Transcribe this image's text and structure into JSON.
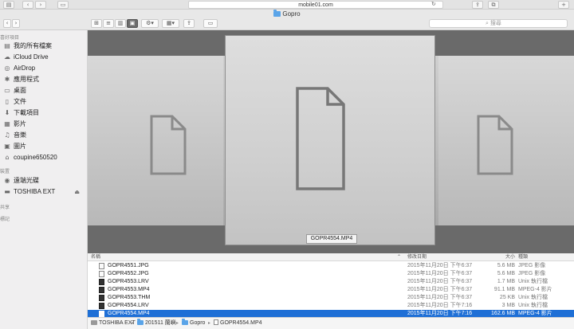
{
  "safari": {
    "url": "mobile01.com",
    "back_icon": "chevron-left-icon",
    "forward_icon": "chevron-right-icon",
    "sidebar_icon": "sidebar-icon",
    "share_icon": "share-icon",
    "reload_icon": "reload-icon",
    "tabs_icon": "tabs-icon"
  },
  "finder": {
    "title": "Gopro",
    "search_placeholder": "搜尋"
  },
  "sidebar": {
    "favorites_header": "喜好項目",
    "favorites": [
      {
        "label": "我的所有檔案",
        "icon": "all-files-icon",
        "glyph": "▤"
      },
      {
        "label": "iCloud Drive",
        "icon": "cloud-icon",
        "glyph": "☁"
      },
      {
        "label": "AirDrop",
        "icon": "airdrop-icon",
        "glyph": "◎"
      },
      {
        "label": "應用程式",
        "icon": "applications-icon",
        "glyph": "✱"
      },
      {
        "label": "桌面",
        "icon": "desktop-icon",
        "glyph": "▭"
      },
      {
        "label": "文件",
        "icon": "documents-icon",
        "glyph": "▯"
      },
      {
        "label": "下載項目",
        "icon": "downloads-icon",
        "glyph": "⬇"
      },
      {
        "label": "影片",
        "icon": "movies-icon",
        "glyph": "▦"
      },
      {
        "label": "音樂",
        "icon": "music-icon",
        "glyph": "♫"
      },
      {
        "label": "圖片",
        "icon": "pictures-icon",
        "glyph": "▣"
      },
      {
        "label": "coupine650520",
        "icon": "home-icon",
        "glyph": "⌂"
      }
    ],
    "devices_header": "裝置",
    "devices": [
      {
        "label": "遠端光碟",
        "icon": "remote-disc-icon",
        "glyph": "◉"
      },
      {
        "label": "TOSHIBA EXT",
        "icon": "external-drive-icon",
        "glyph": "▬",
        "eject": "⏏"
      }
    ],
    "shared_header": "共享",
    "tags_header": "標記"
  },
  "coverflow": {
    "caption": "GOPR4554.MP4"
  },
  "list": {
    "columns": {
      "name": "名稱",
      "date": "修改日期",
      "size": "大小",
      "kind": "種類"
    },
    "sort_indicator": "⌃",
    "rows": [
      {
        "name": "GOPR4551.JPG",
        "date": "2015年11月20日 下午6:37",
        "size": "5.6 MB",
        "kind": "JPEG 影像",
        "icon": "jpeg-file-icon"
      },
      {
        "name": "GOPR4552.JPG",
        "date": "2015年11月20日 下午6:37",
        "size": "5.6 MB",
        "kind": "JPEG 影像",
        "icon": "jpeg-file-icon"
      },
      {
        "name": "GOPR4553.LRV",
        "date": "2015年11月20日 下午6:37",
        "size": "1.7 MB",
        "kind": "Unix 執行檔",
        "icon": "executable-file-icon"
      },
      {
        "name": "GOPR4553.MP4",
        "date": "2015年11月20日 下午6:37",
        "size": "91.1 MB",
        "kind": "MPEG-4 影片",
        "icon": "video-file-icon"
      },
      {
        "name": "GOPR4553.THM",
        "date": "2015年11月20日 下午6:37",
        "size": "25 KB",
        "kind": "Unix 執行檔",
        "icon": "executable-file-icon"
      },
      {
        "name": "GOPR4554.LRV",
        "date": "2015年11月20日 下午7:16",
        "size": "3 MB",
        "kind": "Unix 執行檔",
        "icon": "executable-file-icon"
      },
      {
        "name": "GOPR4554.MP4",
        "date": "2015年11月20日 下午7:16",
        "size": "162.6 MB",
        "kind": "MPEG-4 影片",
        "icon": "video-file-icon",
        "selected": true
      }
    ]
  },
  "pathbar": {
    "items": [
      "TOSHIBA EXT",
      "201511 蘭嶼",
      "Gopro",
      "GOPR4554.MP4"
    ],
    "separator": "▸"
  },
  "colors": {
    "selection": "#1e6fd6",
    "folder": "#5aa4e8",
    "coverflow_dark": "#6a6a6a"
  }
}
